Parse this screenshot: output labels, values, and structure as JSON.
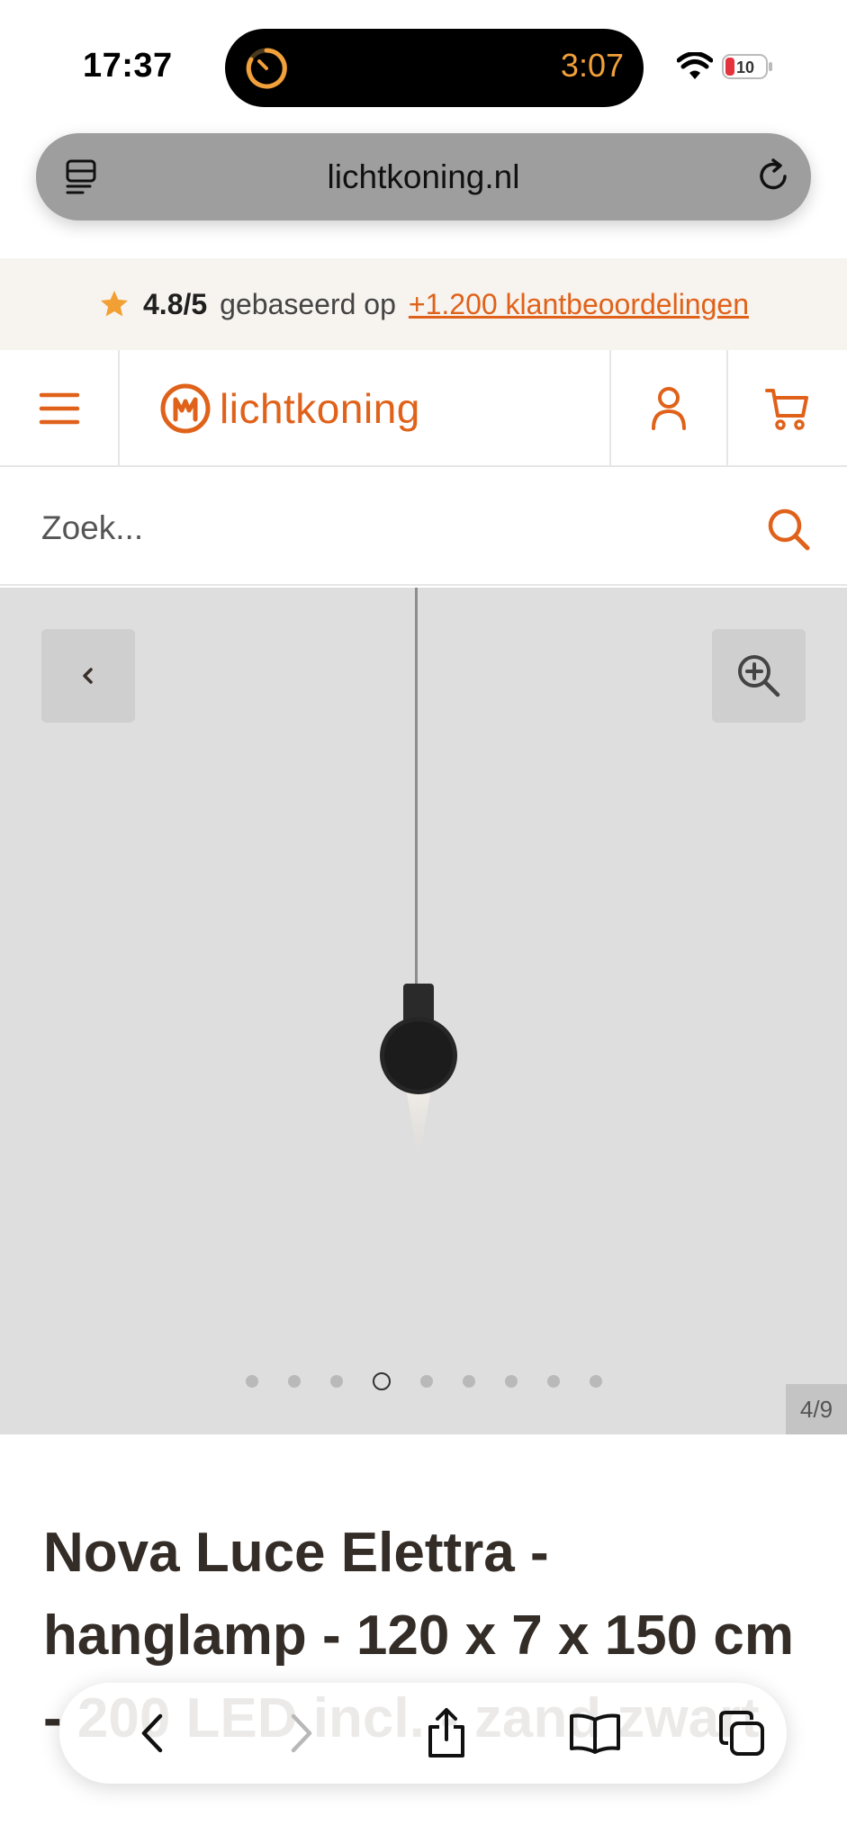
{
  "status_bar": {
    "time": "17:37",
    "island_timer": "3:07",
    "battery_level": "10",
    "icons": [
      "timer-icon",
      "wifi-icon",
      "battery-icon"
    ]
  },
  "browser": {
    "url": "lichtkoning.nl",
    "icons": [
      "reader-icon",
      "reload-icon"
    ]
  },
  "rating": {
    "score": "4.8/5",
    "text": "gebaseerd op",
    "link": "+1.200 klantbeoordelingen",
    "star_color": "#f2a033"
  },
  "header": {
    "logo_text": "lichtkoning",
    "brand_color": "#e0621a",
    "icons": [
      "hamburger-menu-icon",
      "account-icon",
      "cart-icon"
    ]
  },
  "search": {
    "placeholder": "Zoek..."
  },
  "gallery": {
    "counter": "4/9",
    "total_dots": 9,
    "active_dot": 4,
    "icons": [
      "chevron-left-icon",
      "zoom-in-icon"
    ]
  },
  "product": {
    "title": "Nova Luce Elettra - hanglamp - 120 x 7 x 150 cm - 200 LED incl. - zand zwart"
  },
  "toolbar": {
    "icons": [
      "back-icon",
      "forward-icon",
      "share-icon",
      "bookmarks-icon",
      "tabs-icon"
    ]
  }
}
